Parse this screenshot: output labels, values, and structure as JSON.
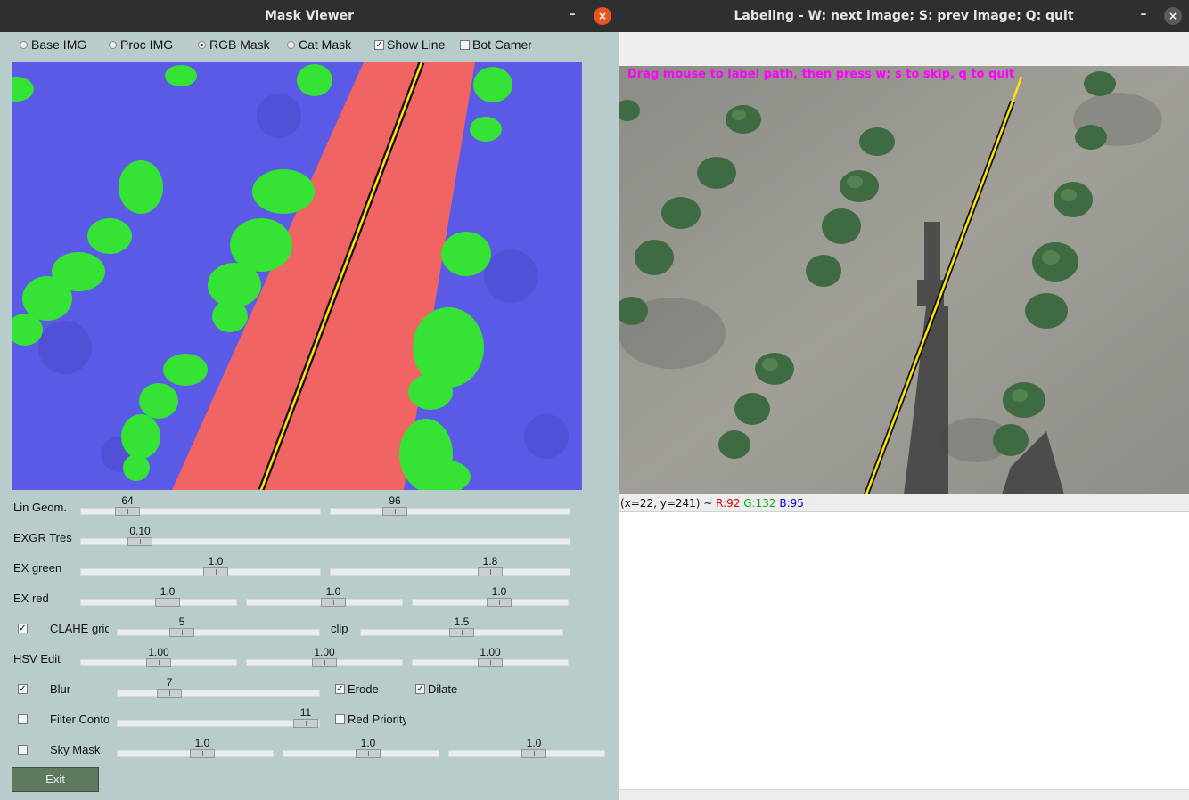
{
  "left_window": {
    "title": "Mask Viewer",
    "minimize_symbol": "–",
    "close_symbol": "×",
    "view_modes": [
      {
        "label": "Base IMG",
        "selected": false
      },
      {
        "label": "Proc IMG",
        "selected": false
      },
      {
        "label": "RGB Mask",
        "selected": true
      },
      {
        "label": "Cat Mask",
        "selected": false
      }
    ],
    "show_line": {
      "label": "Show Line",
      "checked": true,
      "mark": "✓"
    },
    "bot_camera": {
      "label": "Bot Camera",
      "checked": false,
      "mark": ""
    },
    "controls": {
      "lin_geom": {
        "label": "Lin Geom.",
        "values": [
          "64",
          "96"
        ],
        "positions": [
          0.21,
          0.27
        ]
      },
      "exgr_tres": {
        "label": "EXGR Tres",
        "values": [
          "0.10"
        ],
        "positions": [
          0.12
        ]
      },
      "ex_green": {
        "label": "EX green",
        "values": [
          "1.0",
          "1.8"
        ],
        "positions": [
          0.56,
          0.67
        ]
      },
      "ex_red": {
        "label": "EX red",
        "values": [
          "1.0",
          "1.0",
          "1.0"
        ],
        "positions": [
          0.56,
          0.56,
          0.56
        ]
      },
      "clahe": {
        "label": "CLAHE grid",
        "checked": true,
        "mark": "✓",
        "value": "5",
        "position": 0.32,
        "clip_label": "clip",
        "clip_value": "1.5",
        "clip_position": 0.5
      },
      "hsv_edit": {
        "label": "HSV Edit",
        "values": [
          "1.00",
          "1.00",
          "1.00"
        ],
        "positions": [
          0.5,
          0.5,
          0.5
        ]
      },
      "blur": {
        "label": "Blur",
        "checked": true,
        "mark": "✓",
        "value": "7",
        "position": 0.26
      },
      "erode": {
        "label": "Erode",
        "checked": true,
        "mark": "✓"
      },
      "dilate": {
        "label": "Dilate",
        "checked": true,
        "mark": "✓"
      },
      "filter_contours": {
        "label": "Filter Contours",
        "checked": false,
        "mark": "",
        "value": "11",
        "position": 0.93
      },
      "red_priority": {
        "label": "Red Priority",
        "checked": false,
        "mark": ""
      },
      "sky_mask": {
        "label": "Sky Mask",
        "checked": false,
        "mark": "",
        "values": [
          "1.0",
          "1.0",
          "1.0"
        ],
        "positions": [
          0.55,
          0.55,
          0.55
        ]
      }
    },
    "exit_label": "Exit",
    "colors": {
      "background": "#b7cccb",
      "mask_soil": "#5a5ae6",
      "mask_plant": "#34e334",
      "mask_path": "#f06464",
      "path_line": "#ffe600"
    }
  },
  "right_window": {
    "title": "Labeling - W: next image; S: prev image; Q: quit",
    "minimize_symbol": "–",
    "close_symbol": "×",
    "overlay_text": "Drag mouse to label path, then press w; s to skip, q to quit",
    "status": {
      "coords": "(x=22, y=241) ~ ",
      "r": "R:92",
      "g": "G:132",
      "b": "B:95"
    },
    "colors": {
      "overlay_text": "#ff00ff",
      "r": "#e00000",
      "g": "#00b000",
      "b": "#0000d0"
    }
  }
}
